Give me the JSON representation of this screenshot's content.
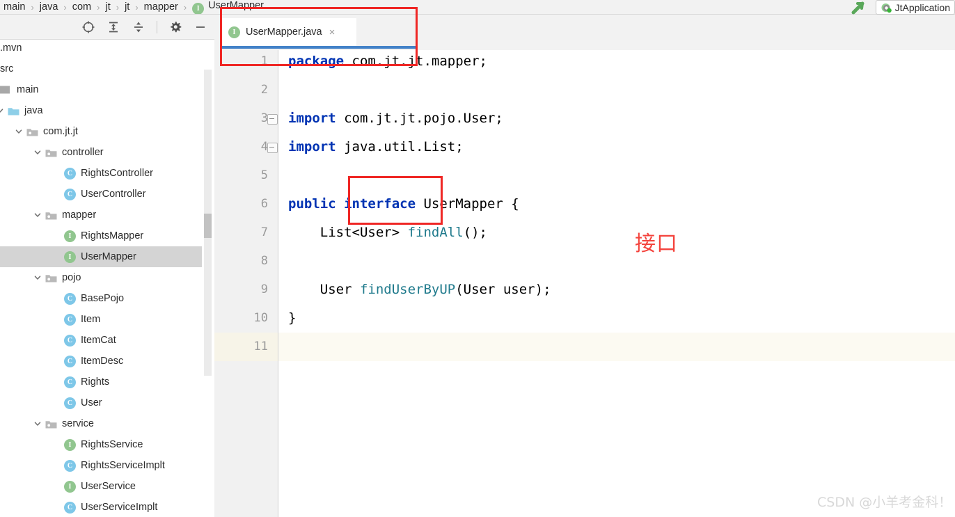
{
  "breadcrumb": {
    "items": [
      "main",
      "java",
      "com",
      "jt",
      "jt",
      "mapper",
      "UserMapper"
    ],
    "separator": "›",
    "last_icon": "interface-badge-icon",
    "last_badge_letter": "I"
  },
  "run_widget": {
    "wrench_icon": "green-arrow-icon",
    "config_icon": "spring-boot-icon",
    "config_label": "JtApplication"
  },
  "project_toolbar": {
    "buttons": [
      {
        "name": "select-opened-file-icon",
        "glyph": "crosshair"
      },
      {
        "name": "expand-all-icon",
        "glyph": "expand"
      },
      {
        "name": "collapse-all-icon",
        "glyph": "collapse"
      },
      {
        "name": "settings-gear-icon",
        "glyph": "gear"
      },
      {
        "name": "hide-panel-icon",
        "glyph": "minus"
      }
    ]
  },
  "tree": {
    "scrollbar": {
      "name": "project-scrollbar"
    },
    "items": [
      {
        "label": ".mvn",
        "indent": 0,
        "kind": "folder-clipped",
        "arrow": "none",
        "selected": false
      },
      {
        "label": "src",
        "indent": 0,
        "kind": "folder-clipped",
        "arrow": "none",
        "selected": false
      },
      {
        "label": "main",
        "indent": 0,
        "kind": "folder-gray",
        "arrow": "none",
        "selected": false
      },
      {
        "label": "java",
        "indent": 1,
        "kind": "folder-blue",
        "arrow": "expanded",
        "selected": false
      },
      {
        "label": "com.jt.jt",
        "indent": 2,
        "kind": "folder-pkg",
        "arrow": "expanded",
        "selected": false
      },
      {
        "label": "controller",
        "indent": 3,
        "kind": "folder-pkg",
        "arrow": "expanded",
        "selected": false
      },
      {
        "label": "RightsController",
        "indent": 4,
        "kind": "class",
        "arrow": "none",
        "selected": false
      },
      {
        "label": "UserController",
        "indent": 4,
        "kind": "class",
        "arrow": "none",
        "selected": false
      },
      {
        "label": "mapper",
        "indent": 3,
        "kind": "folder-pkg",
        "arrow": "expanded",
        "selected": false
      },
      {
        "label": "RightsMapper",
        "indent": 4,
        "kind": "interface",
        "arrow": "none",
        "selected": false
      },
      {
        "label": "UserMapper",
        "indent": 4,
        "kind": "interface",
        "arrow": "none",
        "selected": true
      },
      {
        "label": "pojo",
        "indent": 3,
        "kind": "folder-pkg",
        "arrow": "expanded",
        "selected": false
      },
      {
        "label": "BasePojo",
        "indent": 4,
        "kind": "class",
        "arrow": "none",
        "selected": false
      },
      {
        "label": "Item",
        "indent": 4,
        "kind": "class",
        "arrow": "none",
        "selected": false
      },
      {
        "label": "ItemCat",
        "indent": 4,
        "kind": "class",
        "arrow": "none",
        "selected": false
      },
      {
        "label": "ItemDesc",
        "indent": 4,
        "kind": "class",
        "arrow": "none",
        "selected": false
      },
      {
        "label": "Rights",
        "indent": 4,
        "kind": "class",
        "arrow": "none",
        "selected": false
      },
      {
        "label": "User",
        "indent": 4,
        "kind": "class",
        "arrow": "none",
        "selected": false
      },
      {
        "label": "service",
        "indent": 3,
        "kind": "folder-pkg",
        "arrow": "expanded",
        "selected": false
      },
      {
        "label": "RightsService",
        "indent": 4,
        "kind": "interface",
        "arrow": "none",
        "selected": false
      },
      {
        "label": "RightsServiceImplt",
        "indent": 4,
        "kind": "class",
        "arrow": "none",
        "selected": false
      },
      {
        "label": "UserService",
        "indent": 4,
        "kind": "interface",
        "arrow": "none",
        "selected": false
      },
      {
        "label": "UserServiceImplt",
        "indent": 4,
        "kind": "class",
        "arrow": "none",
        "selected": false
      }
    ]
  },
  "editor": {
    "tab": {
      "label": "UserMapper.java",
      "badge_letter": "I",
      "badge_icon": "interface-badge-icon",
      "close_icon": "close-icon",
      "close_glyph": "×",
      "active": true
    },
    "line_numbers": [
      "1",
      "2",
      "3",
      "4",
      "5",
      "6",
      "7",
      "8",
      "9",
      "10",
      "11"
    ],
    "caret_line": 11,
    "lines": [
      {
        "n": 1,
        "segments": [
          {
            "t": "package ",
            "c": "kw"
          },
          {
            "t": "com.jt.jt.mapper;",
            "c": "plain"
          }
        ],
        "fold": false
      },
      {
        "n": 2,
        "segments": [],
        "fold": false
      },
      {
        "n": 3,
        "segments": [
          {
            "t": "import ",
            "c": "kw"
          },
          {
            "t": "com.jt.jt.pojo.User;",
            "c": "plain"
          }
        ],
        "fold": true
      },
      {
        "n": 4,
        "segments": [
          {
            "t": "import ",
            "c": "kw"
          },
          {
            "t": "java.util.List;",
            "c": "plain"
          }
        ],
        "fold": true
      },
      {
        "n": 5,
        "segments": [],
        "fold": false
      },
      {
        "n": 6,
        "segments": [
          {
            "t": "public ",
            "c": "kw"
          },
          {
            "t": "interface ",
            "c": "kw"
          },
          {
            "t": "UserMapper {",
            "c": "plain"
          }
        ],
        "fold": false
      },
      {
        "n": 7,
        "segments": [
          {
            "t": "    List<User> ",
            "c": "plain"
          },
          {
            "t": "findAll",
            "c": "mth"
          },
          {
            "t": "();",
            "c": "plain"
          }
        ],
        "fold": false
      },
      {
        "n": 8,
        "segments": [],
        "fold": false
      },
      {
        "n": 9,
        "segments": [
          {
            "t": "    User ",
            "c": "plain"
          },
          {
            "t": "findUserByUP",
            "c": "mth"
          },
          {
            "t": "(User user);",
            "c": "plain"
          }
        ],
        "fold": false
      },
      {
        "n": 10,
        "segments": [
          {
            "t": "}",
            "c": "plain"
          }
        ],
        "fold": false
      },
      {
        "n": 11,
        "segments": [],
        "fold": false
      }
    ]
  },
  "annotations": {
    "tab_box_label": "highlight-editor-tab",
    "interface_box_label": "highlight-interface-keyword",
    "note_text": "接口"
  },
  "watermark": {
    "text": "CSDN @小羊考金科！"
  },
  "colors": {
    "accent_blue": "#4382c8",
    "annotation_red": "#ef2725",
    "interface_green": "#91c68f",
    "class_blue": "#7ec7e8",
    "keyword_blue": "#0033b3",
    "method_teal": "#1f7a8c",
    "caret_line_bg": "#fcfaf2",
    "selection_gray": "#d4d4d4"
  }
}
